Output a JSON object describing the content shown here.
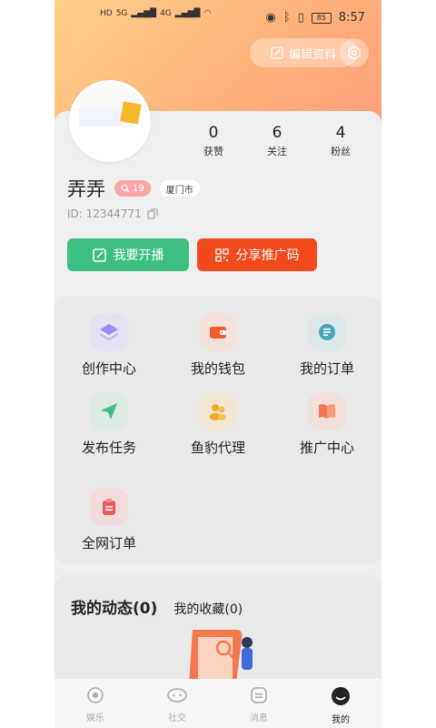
{
  "status_bar": {
    "left_badges": [
      "HD",
      "5G",
      "HD",
      "4G"
    ],
    "battery": "85",
    "time": "8:57"
  },
  "header": {
    "edit_profile": "编辑资料"
  },
  "profile": {
    "name": "弄弄",
    "level": "19",
    "city": "厦门市",
    "id_text": "ID: 12344771",
    "stats": [
      {
        "value": "0",
        "label": "获赞"
      },
      {
        "value": "6",
        "label": "关注"
      },
      {
        "value": "4",
        "label": "粉丝"
      }
    ],
    "live_button": "我要开播",
    "share_button": "分享推广码"
  },
  "menu": {
    "items": [
      {
        "label": "创作中心",
        "icon": "layers-icon",
        "color": "#9b8cf5"
      },
      {
        "label": "我的钱包",
        "icon": "wallet-icon",
        "color": "#f25c2a"
      },
      {
        "label": "我的订单",
        "icon": "order-list-icon",
        "color": "#47a6b8"
      },
      {
        "label": "发布任务",
        "icon": "send-icon",
        "color": "#3dbf84"
      },
      {
        "label": "鱼豹代理",
        "icon": "agent-users-icon",
        "color": "#f5a623"
      },
      {
        "label": "推广中心",
        "icon": "book-icon",
        "color": "#f27a52"
      },
      {
        "label": "全网订单",
        "icon": "clipboard-icon",
        "color": "#ee5a5a"
      }
    ]
  },
  "dynamics": {
    "tab_active": "我的动态(0)",
    "tab_inactive": "我的收藏(0)"
  },
  "bottom_nav": {
    "items": [
      {
        "label": "娱乐",
        "icon": "record-icon"
      },
      {
        "label": "社交",
        "icon": "chat-bubble-icon"
      },
      {
        "label": "消息",
        "icon": "message-icon"
      },
      {
        "label": "我的",
        "icon": "profile-icon"
      }
    ],
    "active_index": 3
  }
}
